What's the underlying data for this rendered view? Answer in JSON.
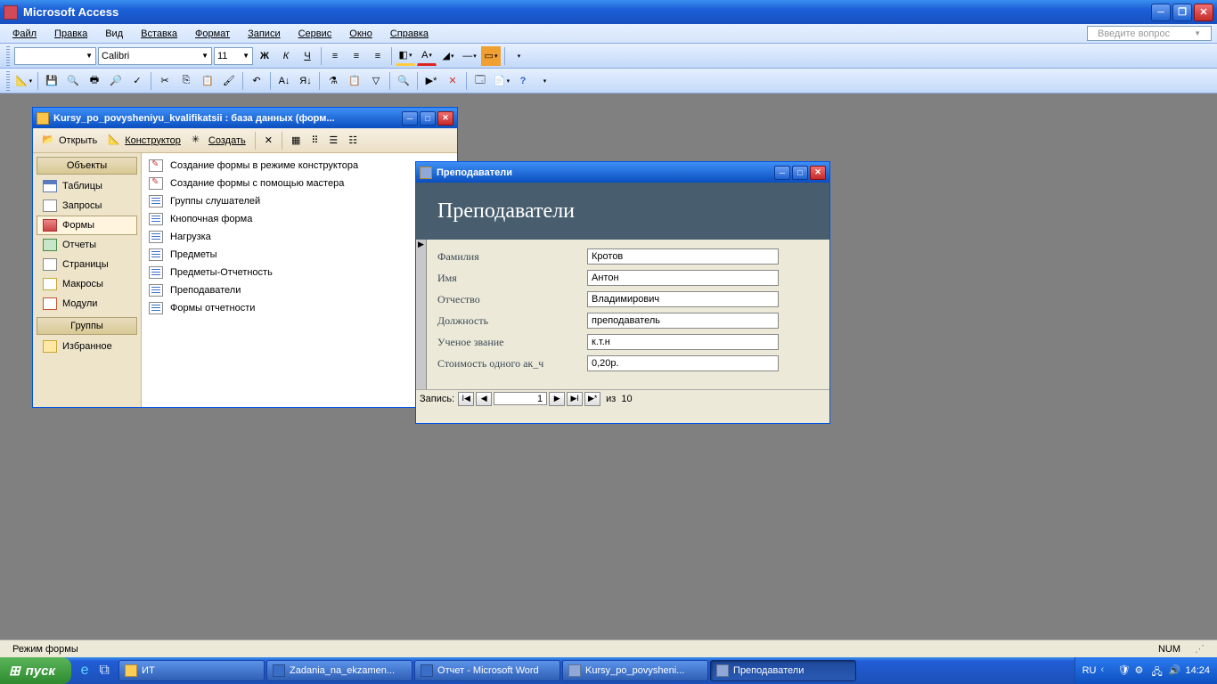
{
  "app": {
    "title": "Microsoft Access"
  },
  "menu": {
    "items": [
      "Файл",
      "Правка",
      "Вид",
      "Вставка",
      "Формат",
      "Записи",
      "Сервис",
      "Окно",
      "Справка"
    ],
    "helpbox_placeholder": "Введите вопрос"
  },
  "format_toolbar": {
    "style": "",
    "font": "Calibri",
    "size": "11"
  },
  "db_window": {
    "title": "Kursy_po_povysheniyu_kvalifikatsii : база данных (форм...",
    "toolbar": {
      "open": "Открыть",
      "design": "Конструктор",
      "create": "Создать"
    },
    "nav": {
      "group_top": "Объекты",
      "group_bottom": "Группы",
      "items": [
        "Таблицы",
        "Запросы",
        "Формы",
        "Отчеты",
        "Страницы",
        "Макросы",
        "Модули"
      ],
      "favorites": "Избранное",
      "selected_index": 2
    },
    "list": [
      {
        "t": "Создание формы в режиме конструктора",
        "k": "wiz"
      },
      {
        "t": "Создание формы с помощью мастера",
        "k": "wiz"
      },
      {
        "t": "Группы слушателей",
        "k": "form"
      },
      {
        "t": "Кнопочная форма",
        "k": "form"
      },
      {
        "t": "Нагрузка",
        "k": "form"
      },
      {
        "t": "Предметы",
        "k": "form"
      },
      {
        "t": "Предметы-Отчетность",
        "k": "form"
      },
      {
        "t": "Преподаватели",
        "k": "form"
      },
      {
        "t": "Формы отчетности",
        "k": "form"
      }
    ]
  },
  "form_window": {
    "title": "Преподаватели",
    "header": "Преподаватели",
    "fields": [
      {
        "label": "Фамилия",
        "value": "Кротов"
      },
      {
        "label": "Имя",
        "value": "Антон"
      },
      {
        "label": "Отчество",
        "value": "Владимирович"
      },
      {
        "label": "Должность",
        "value": "преподаватель"
      },
      {
        "label": "Ученое звание",
        "value": "к.т.н"
      },
      {
        "label": "Стоимость одного ак_ч",
        "value": "0,20р."
      }
    ],
    "recnav": {
      "label": "Запись:",
      "current": "1",
      "of_label": "из",
      "total": "10"
    }
  },
  "statusbar": {
    "mode": "Режим формы",
    "num": "NUM"
  },
  "taskbar": {
    "start": "пуск",
    "tasks": [
      {
        "label": "ИТ",
        "color": "#ffcc55"
      },
      {
        "label": "Zadania_na_ekzamen...",
        "color": "#3a6fc9"
      },
      {
        "label": "Отчет - Microsoft Word",
        "color": "#3a6fc9"
      },
      {
        "label": "Kursy_po_povysheni...",
        "color": "#8fa8d8"
      },
      {
        "label": "Преподаватели",
        "color": "#8fa8d8",
        "active": true
      }
    ],
    "tray": {
      "lang": "RU",
      "time": "14:24"
    }
  }
}
